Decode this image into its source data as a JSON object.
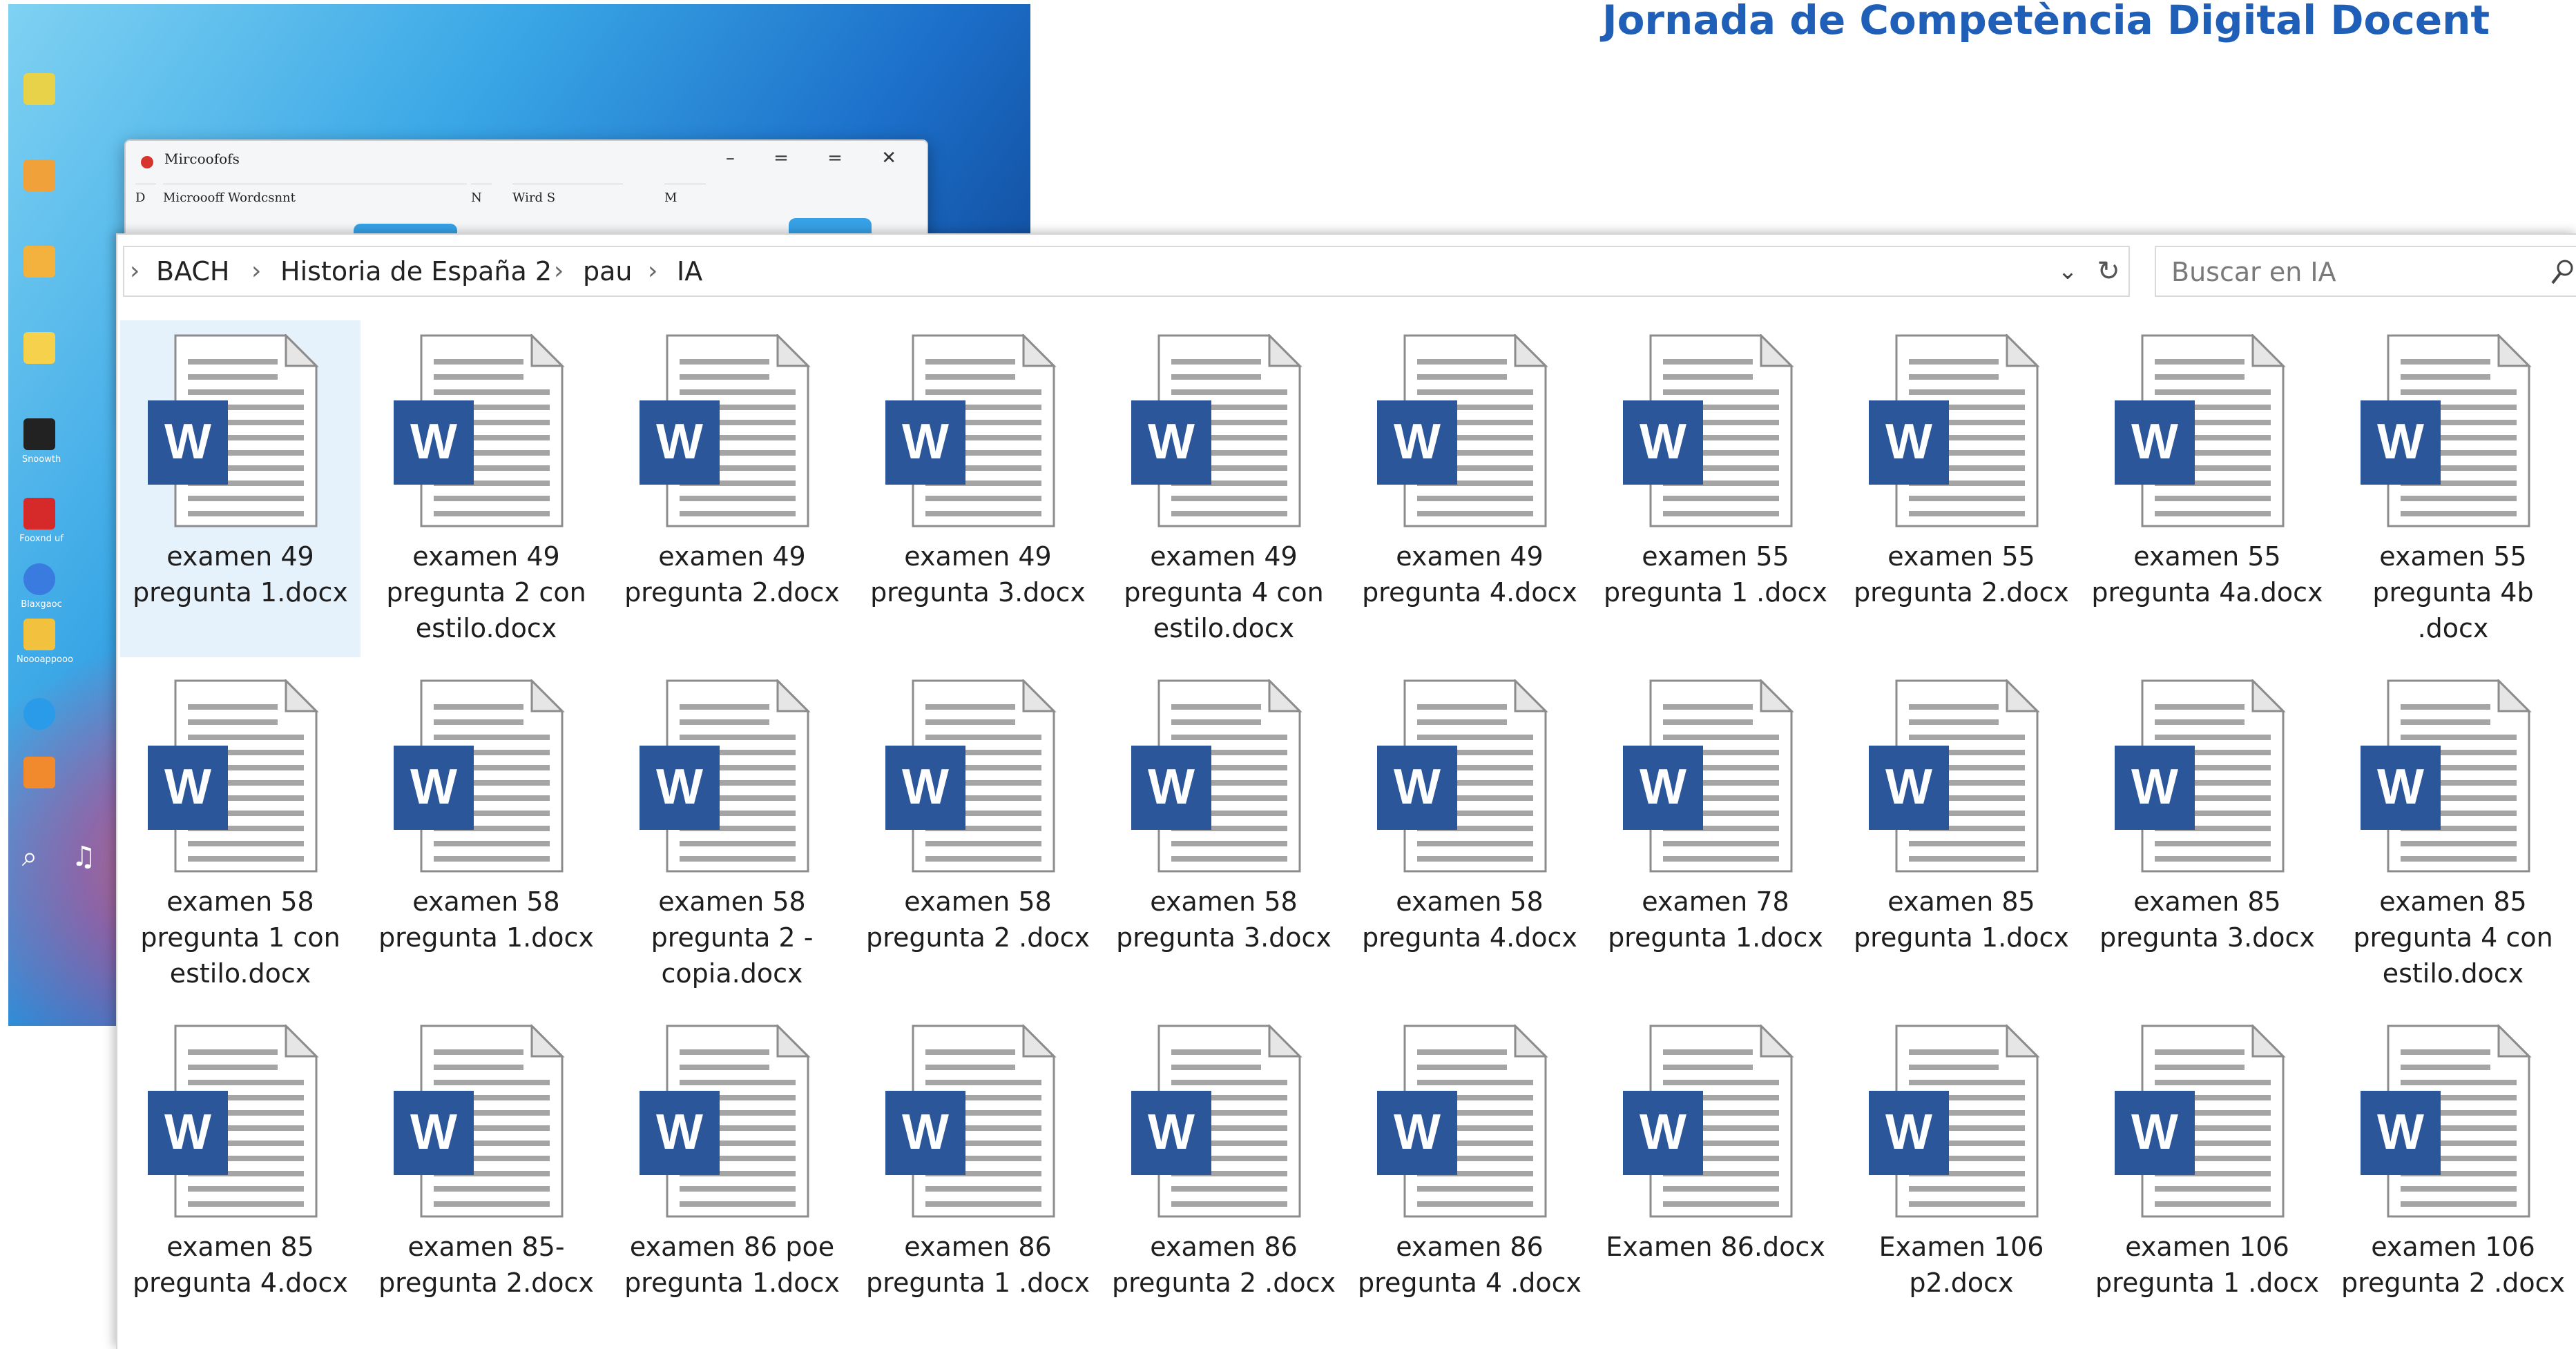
{
  "slide": {
    "heading": "Jornada de Competència Digital Docent"
  },
  "background_window": {
    "title": "Mircoofofs",
    "tab1": "Microooff Wordcsnnt",
    "tab2": "Wird S",
    "tab_prefix": "D",
    "tab_n": "N",
    "tab_m": "M",
    "desktop_labels": [
      "",
      "",
      "",
      "",
      "",
      "Snoowth",
      "Fooxnd uf",
      "Blaxgaoc",
      "Noooappooo",
      ""
    ]
  },
  "explorer": {
    "breadcrumb": [
      "BACH",
      "Historia de España 2",
      "pau",
      "IA"
    ],
    "search_placeholder": "Buscar en IA",
    "icons": {
      "dropdown": "chevron-down-icon",
      "refresh": "refresh-icon",
      "search": "search-icon",
      "file": "word-document-icon"
    },
    "colors": {
      "word_blue": "#2b579a",
      "selection": "#e5f1fb",
      "heading_blue": "#1f5fb8"
    },
    "files": [
      {
        "name": "examen 49 pregunta 1.docx",
        "selected": true
      },
      {
        "name": "examen 49 pregunta 2 con estilo.docx"
      },
      {
        "name": "examen 49 pregunta 2.docx"
      },
      {
        "name": "examen 49 pregunta 3.docx"
      },
      {
        "name": "examen 49 pregunta 4 con estilo.docx"
      },
      {
        "name": "examen 49 pregunta 4.docx"
      },
      {
        "name": "examen 55 pregunta 1 .docx"
      },
      {
        "name": "examen 55 pregunta 2.docx"
      },
      {
        "name": "examen 55 pregunta 4a.docx"
      },
      {
        "name": "examen 55 pregunta 4b .docx"
      },
      {
        "name": "examen 58 pregunta 1 con estilo.docx"
      },
      {
        "name": "examen 58 pregunta 1.docx"
      },
      {
        "name": "examen 58 pregunta 2  - copia.docx"
      },
      {
        "name": "examen 58 pregunta 2 .docx"
      },
      {
        "name": "examen 58 pregunta 3.docx"
      },
      {
        "name": "examen 58 pregunta 4.docx"
      },
      {
        "name": "examen 78 pregunta 1.docx"
      },
      {
        "name": "examen 85 pregunta 1.docx"
      },
      {
        "name": "examen 85 pregunta 3.docx"
      },
      {
        "name": "examen 85 pregunta 4 con estilo.docx"
      },
      {
        "name": "examen 85 pregunta 4.docx"
      },
      {
        "name": "examen 85-pregunta 2.docx"
      },
      {
        "name": "examen 86 poe pregunta 1.docx"
      },
      {
        "name": "examen 86 pregunta 1 .docx"
      },
      {
        "name": "examen 86 pregunta 2 .docx"
      },
      {
        "name": "examen 86 pregunta 4 .docx"
      },
      {
        "name": "Examen 86.docx"
      },
      {
        "name": "Examen 106 p2.docx"
      },
      {
        "name": "examen 106 pregunta 1 .docx"
      },
      {
        "name": "examen 106 pregunta 2 .docx"
      }
    ]
  }
}
